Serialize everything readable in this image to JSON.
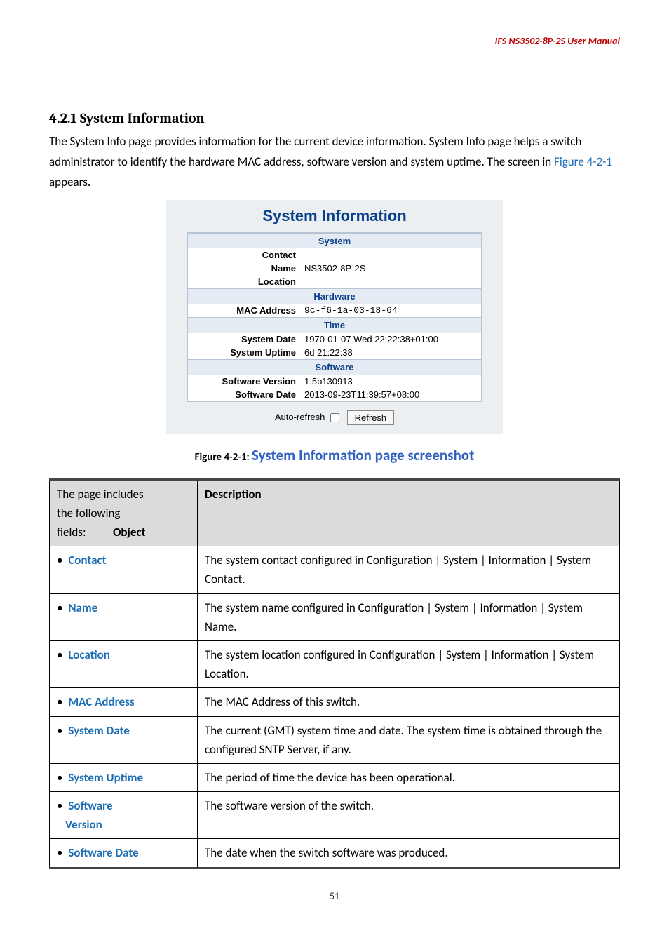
{
  "header": {
    "right": "IFS  NS3502-8P-2S  User  Manual"
  },
  "section": {
    "number": "4.2.1",
    "title": "System Information",
    "intro_part1": "The System Info page provides information for the current device information. System Info page helps a switch administrator to identify the hardware MAC address, software version and system uptime. The screen in ",
    "intro_link": "Figure 4-2-1",
    "intro_part2": " appears."
  },
  "panel": {
    "title": "System Information",
    "groups": {
      "system": {
        "header": "System",
        "contact_label": "Contact",
        "contact_value": "",
        "name_label": "Name",
        "name_value": "NS3502-8P-2S",
        "location_label": "Location",
        "location_value": ""
      },
      "hardware": {
        "header": "Hardware",
        "mac_label": "MAC Address",
        "mac_value": "9c-f6-1a-03-18-64"
      },
      "time": {
        "header": "Time",
        "date_label": "System Date",
        "date_value": "1970-01-07 Wed 22:22:38+01:00",
        "uptime_label": "System Uptime",
        "uptime_value": "6d 21:22:38"
      },
      "software": {
        "header": "Software",
        "version_label": "Software Version",
        "version_value": "1.5b130913",
        "swdate_label": "Software Date",
        "swdate_value": "2013-09-23T11:39:57+08:00"
      }
    },
    "controls": {
      "auto_refresh_label": "Auto-refresh",
      "refresh_label": "Refresh"
    }
  },
  "figure": {
    "label": "Figure 4-2-1: ",
    "title": "System Information page screenshot"
  },
  "table": {
    "header_col1_line1": "The page includes",
    "header_col1_line2": "the following",
    "header_col1_line3a": "fields:",
    "header_col1_line3b": "Object",
    "header_col2": "Description",
    "rows": [
      {
        "object": "Contact",
        "desc": "The system contact configured in Configuration | System | Information | System Contact."
      },
      {
        "object": "Name",
        "desc": "The system name configured in Configuration | System | Information | System Name."
      },
      {
        "object": "Location",
        "desc": "The system location configured in Configuration | System | Information | System Location."
      },
      {
        "object": "MAC Address",
        "desc": "The MAC Address of this switch."
      },
      {
        "object": "System Date",
        "desc": "The current (GMT) system time and date. The system time is obtained through the configured SNTP Server, if any."
      },
      {
        "object": "System Uptime",
        "desc": "The period of time the device has been operational."
      },
      {
        "object_line1": "Software",
        "object_line2": "Version",
        "desc": "The software version of the switch."
      },
      {
        "object": "Software Date",
        "desc": "The date when the switch software was produced."
      }
    ]
  },
  "footer": {
    "page_number": "51"
  }
}
